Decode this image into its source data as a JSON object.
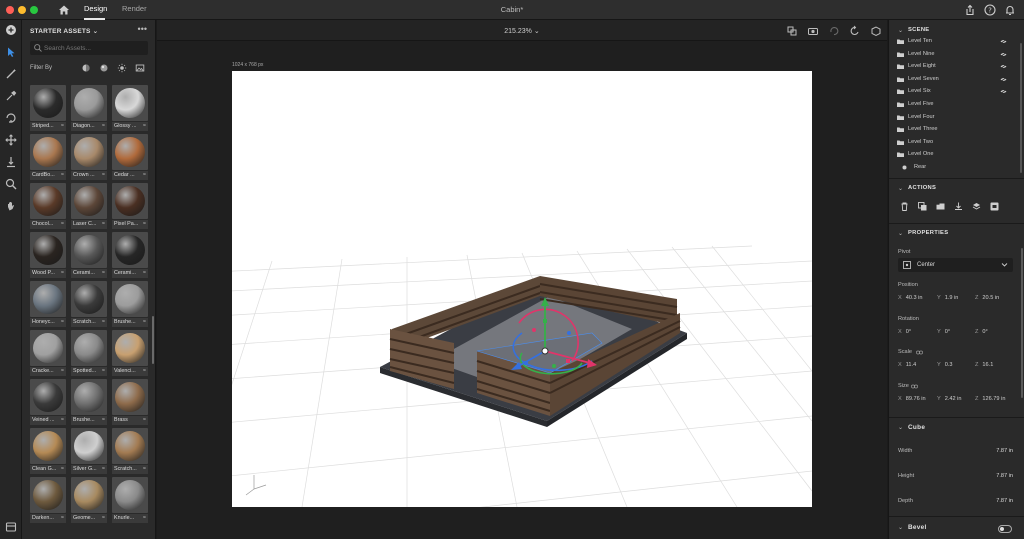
{
  "window": {
    "title": "Cabin*",
    "tabs": [
      {
        "label": "Design",
        "active": true
      },
      {
        "label": "Render",
        "active": false
      }
    ],
    "traffic_colors": [
      "#ff5f57",
      "#febc2e",
      "#28c840"
    ]
  },
  "assets": {
    "header": "STARTER ASSETS",
    "search_placeholder": "Search Assets...",
    "filter_label": "Filter By",
    "items": [
      {
        "name": "Striped...",
        "color": "#2b2b2b"
      },
      {
        "name": "Diagon...",
        "color": "#9a9a9a"
      },
      {
        "name": "Glossy ...",
        "color": "#d8d8d8"
      },
      {
        "name": "CardBo...",
        "color": "#a9774f"
      },
      {
        "name": "Crown ...",
        "color": "#a8896a"
      },
      {
        "name": "Cedar ...",
        "color": "#b06a3b"
      },
      {
        "name": "Chocol...",
        "color": "#5a3a28"
      },
      {
        "name": "Laser C...",
        "color": "#5c4638"
      },
      {
        "name": "Pixel Pa...",
        "color": "#4a2f22"
      },
      {
        "name": "Wood P...",
        "color": "#2a2420"
      },
      {
        "name": "Cerami...",
        "color": "#575757"
      },
      {
        "name": "Cerami...",
        "color": "#262626"
      },
      {
        "name": "Honeyc...",
        "color": "#6a7580"
      },
      {
        "name": "Scratch...",
        "color": "#3a3a3a"
      },
      {
        "name": "Brushe...",
        "color": "#9c9c9c"
      },
      {
        "name": "Cracke...",
        "color": "#a0a0a0"
      },
      {
        "name": "Spotted...",
        "color": "#8a8a8a"
      },
      {
        "name": "Valenci...",
        "color": "#c8a070"
      },
      {
        "name": "Veined ...",
        "color": "#3a3a3a"
      },
      {
        "name": "Brushe...",
        "color": "#707070"
      },
      {
        "name": "Brass",
        "color": "#8e6b4b"
      },
      {
        "name": "Clean G...",
        "color": "#b58a55"
      },
      {
        "name": "Silver G...",
        "color": "#cfcfcf"
      },
      {
        "name": "Scratch...",
        "color": "#a37b52"
      },
      {
        "name": "Darken...",
        "color": "#6e5a3e"
      },
      {
        "name": "Geome...",
        "color": "#a88a60"
      },
      {
        "name": "Knurle...",
        "color": "#8a8a8a"
      }
    ]
  },
  "canvas": {
    "zoom": "215.23%",
    "dimensions": "1024 x 768 px"
  },
  "scene": {
    "header": "SCENE",
    "items": [
      {
        "label": "Level Ten",
        "eye": true
      },
      {
        "label": "Level Nine",
        "eye": true
      },
      {
        "label": "Level Eight",
        "eye": true
      },
      {
        "label": "Level Seven",
        "eye": true
      },
      {
        "label": "Level Six",
        "eye": true
      },
      {
        "label": "Level Five",
        "eye": false
      },
      {
        "label": "Level Four",
        "eye": false
      },
      {
        "label": "Level Three",
        "eye": false
      },
      {
        "label": "Level Two",
        "eye": false
      },
      {
        "label": "Level One",
        "eye": false
      },
      {
        "label": "Rear",
        "eye": false
      }
    ]
  },
  "actions": {
    "header": "ACTIONS"
  },
  "properties": {
    "header": "PROPERTIES",
    "pivot_label": "Pivot",
    "pivot_value": "Center",
    "position_label": "Position",
    "position": {
      "x": "40.3 in",
      "y": "1.9 in",
      "z": "20.5 in"
    },
    "rotation_label": "Rotation",
    "rotation": {
      "x": "0°",
      "y": "0°",
      "z": "0°"
    },
    "scale_label": "Scale",
    "scale": {
      "x": "11.4",
      "y": "0.3",
      "z": "16.1"
    },
    "size_label": "Size",
    "size": {
      "x": "89.76 in",
      "y": "2.42 in",
      "z": "126.79 in"
    },
    "axis": {
      "x": "X",
      "y": "Y",
      "z": "Z"
    }
  },
  "cube": {
    "header": "Cube",
    "width_label": "Width",
    "width": "7.87 in",
    "height_label": "Height",
    "height": "7.87 in",
    "depth_label": "Depth",
    "depth": "7.87 in"
  },
  "bevel": {
    "header": "Bevel"
  }
}
